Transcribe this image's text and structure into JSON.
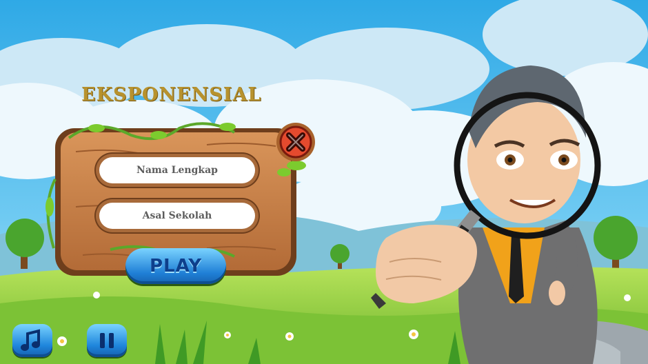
{
  "game": {
    "title": "EKSPONENSIAL",
    "form": {
      "name_placeholder": "Nama Lengkap",
      "school_placeholder": "Asal Sekolah"
    },
    "play_label": "PLAY",
    "icons": {
      "close": "close-icon",
      "music": "music-icon",
      "pause": "pause-icon"
    },
    "colors": {
      "sky": "#33b3ea",
      "title": "#b7922e",
      "board": "#c8814a",
      "button": "#1f86dc",
      "close": "#e0412a",
      "grass": "#8fcf3a"
    }
  }
}
